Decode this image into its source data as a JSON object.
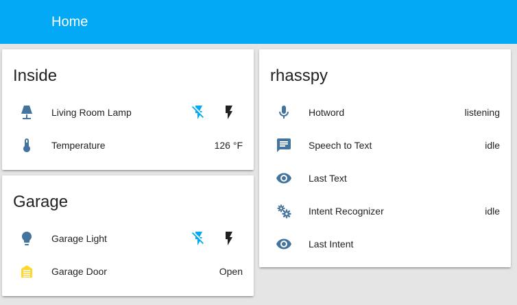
{
  "toolbar": {
    "title": "Home",
    "color": "#03a9f4"
  },
  "cards": {
    "inside": {
      "title": "Inside",
      "rows": [
        {
          "name": "Living Room Lamp",
          "icon": "lamp-icon",
          "off_icon": "flash-off-icon",
          "on_icon": "flash-icon"
        },
        {
          "name": "Temperature",
          "icon": "thermometer-icon",
          "state": "126 °F"
        }
      ]
    },
    "garage": {
      "title": "Garage",
      "rows": [
        {
          "name": "Garage Light",
          "icon": "lightbulb-icon",
          "off_icon": "flash-off-icon",
          "on_icon": "flash-icon"
        },
        {
          "name": "Garage Door",
          "icon": "garage-icon",
          "state": "Open"
        }
      ]
    },
    "rhasspy": {
      "title": "rhasspy",
      "rows": [
        {
          "name": "Hotword",
          "icon": "microphone-icon",
          "state": "listening"
        },
        {
          "name": "Speech to Text",
          "icon": "message-text-icon",
          "state": "idle"
        },
        {
          "name": "Last Text",
          "icon": "eye-icon",
          "state": ""
        },
        {
          "name": "Intent Recognizer",
          "icon": "settings-icon",
          "state": "idle"
        },
        {
          "name": "Last Intent",
          "icon": "eye-icon",
          "state": ""
        }
      ]
    }
  },
  "colors": {
    "icon": "#44739e",
    "active_button": "#03a9f4",
    "inactive_button": "#212121",
    "garage_open": "#fdd835"
  }
}
